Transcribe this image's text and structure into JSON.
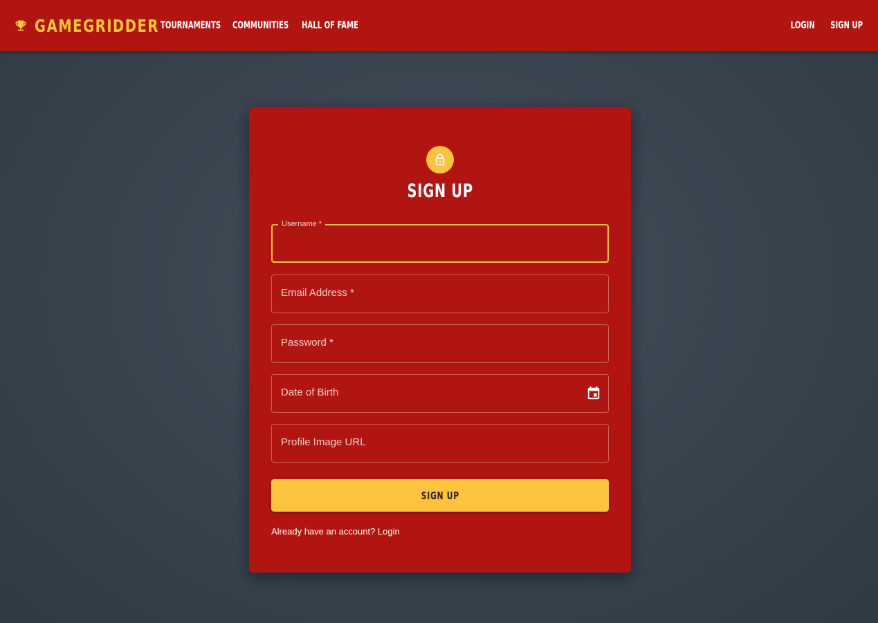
{
  "navbar": {
    "brand": "GAMEGRIDDER",
    "links": [
      "TOURNAMENTS",
      "COMMUNITIES",
      "HALL OF FAME"
    ],
    "login": "LOGIN",
    "signup": "SIGN UP"
  },
  "form": {
    "title": "SIGN UP",
    "fields": [
      {
        "label": "Username *",
        "value": "",
        "focused": true
      },
      {
        "label": "Email Address *",
        "value": ""
      },
      {
        "label": "Password *",
        "value": ""
      },
      {
        "label": "Date of Birth",
        "value": "",
        "icon": "calendar-icon"
      },
      {
        "label": "Profile Image URL",
        "value": ""
      }
    ],
    "submit": "SIGN UP",
    "login_prompt": "Already have an account? Login"
  },
  "colors": {
    "primary": "#b11511",
    "accent": "#fcc43c",
    "background": "#3b4651"
  }
}
